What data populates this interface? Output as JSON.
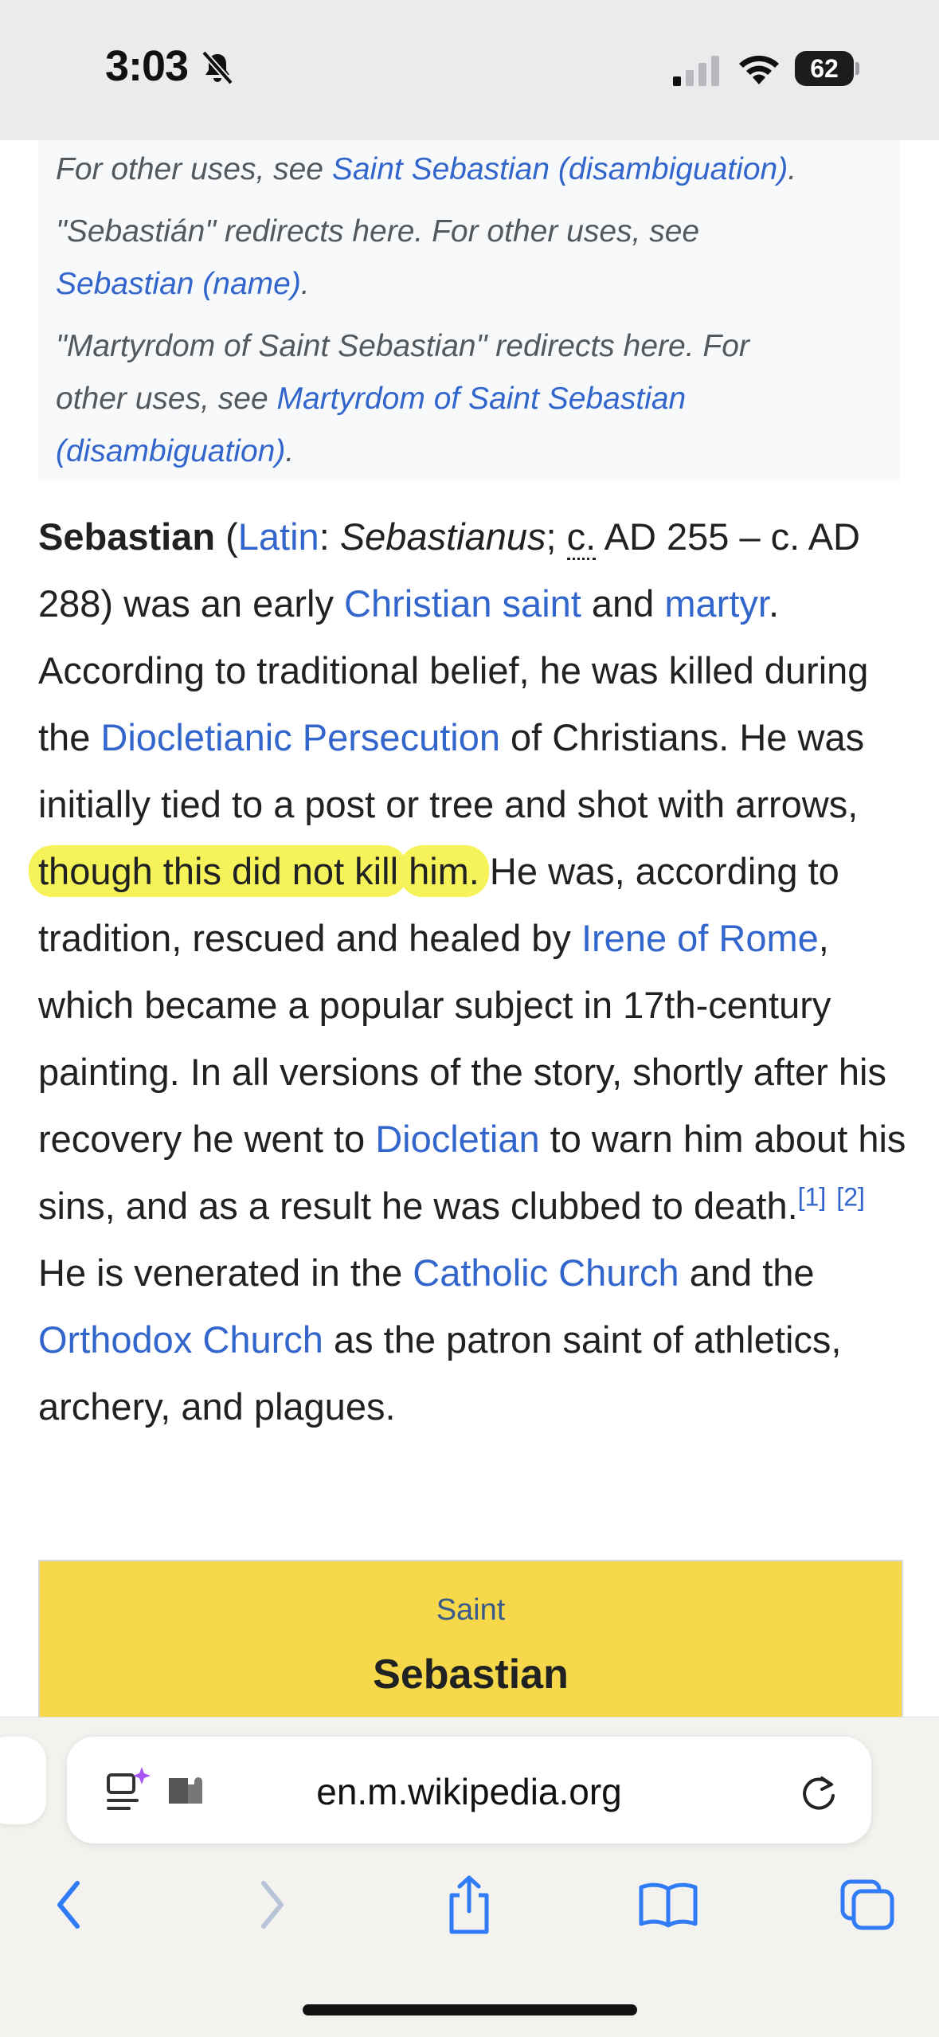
{
  "status_bar": {
    "time": "3:03",
    "battery": "62"
  },
  "hatnote": {
    "line1_prefix": "For other uses, see ",
    "line1_link": "Saint Sebastian (disambiguation)",
    "line1_suffix": ".",
    "line2_prefix": "\"Sebastián\" redirects here. For other uses, see",
    "line2_link": "Sebastian (name)",
    "line2_suffix": ".",
    "line3_prefix_a": "\"Martyrdom of Saint Sebastian\" redirects here. For",
    "line3_prefix_b": "other uses, see ",
    "line3_link_a": "Martyrdom of Saint Sebastian",
    "line3_link_b": "(disambiguation)",
    "line3_suffix": "."
  },
  "article": {
    "bold_name": "Sebastian",
    "t1": " (",
    "link_latin": "Latin",
    "t2": ": ",
    "italic_name": "Sebastianus",
    "t3": "; ",
    "abbr_c": "c.",
    "t4": " AD 255 – c. AD 288) was an early ",
    "link_christian_saint": "Christian saint",
    "t5": " and ",
    "link_martyr": "martyr",
    "t6": ". According to traditional belief, he was killed during the ",
    "link_persecution": "Diocletianic Persecution",
    "t7": " of Christians. He was initially tied to a post or tree and shot with arrows, ",
    "highlight_a": "though this did not kill",
    "highlight_b": "him.",
    "t8": " He was, according to tradition, rescued and healed by ",
    "link_irene": "Irene of Rome",
    "t9": ", which became a popular subject in 17th-century painting. In all versions of the story, shortly after his recovery he went to ",
    "link_diocletian": "Diocletian",
    "t10": " to warn him about his sins, and as a result he was clubbed to death.",
    "ref1": "[1]",
    "ref2": "[2]",
    "t11": " He is venerated in the ",
    "link_catholic": "Catholic Church",
    "t12": " and the ",
    "link_orthodox": "Orthodox Church",
    "t13": " as the patron saint of athletics, archery, and plagues."
  },
  "infobox": {
    "subtitle": "Saint",
    "title": "Sebastian"
  },
  "browser": {
    "url": "en.m.wikipedia.org"
  },
  "colors": {
    "link": "#3366cc",
    "highlight": "#f6f25a",
    "infobox": "#f7d84a",
    "safari_blue": "#2f7cf6"
  }
}
